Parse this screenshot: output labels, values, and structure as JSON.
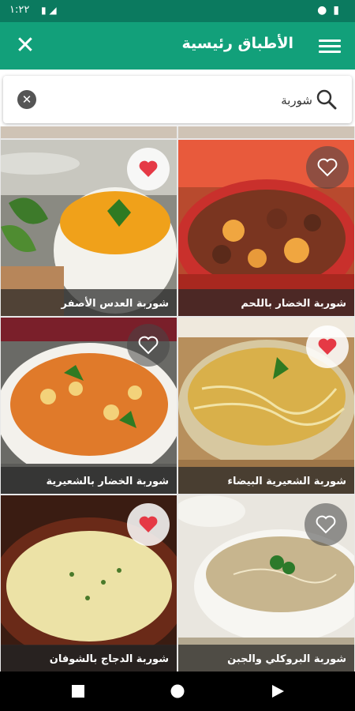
{
  "status_bar": {
    "time": "١:٢٢"
  },
  "app_bar": {
    "title": "الأطباق رئيسية"
  },
  "search": {
    "value": "شوربة",
    "placeholder": ""
  },
  "recipes": [
    {
      "name": "شوربة الخضار باللحم",
      "favorite": false
    },
    {
      "name": "شوربة العدس الأصفر",
      "favorite": true
    },
    {
      "name": "شوربة الشعيرية البيضاء",
      "favorite": true
    },
    {
      "name": "شوربة الخضار بالشعيرية",
      "favorite": false
    },
    {
      "name": "شوربة البروكلي والجبن",
      "favorite": false
    },
    {
      "name": "شوربة الدجاج بالشوفان",
      "favorite": true
    }
  ],
  "colors": {
    "primary": "#12a07a",
    "primary_dark": "#0b7a5f",
    "heart": "#e53945"
  }
}
